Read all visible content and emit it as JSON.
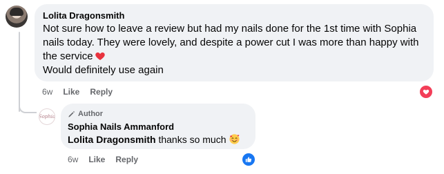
{
  "comment": {
    "author": "Lolita Dragonsmith",
    "text": "Not sure how to leave a review but had my nails done for the 1st time with Sophia nails today. They were lovely, and despite a power cut I was more than happy with the service",
    "text_line2": "Would definitely use again",
    "time": "6w",
    "like_label": "Like",
    "reply_label": "Reply",
    "reaction_icon": "love-reaction-icon",
    "reaction_color": "#f33e58"
  },
  "reply": {
    "badge": "Author",
    "author": "Sophia Nails Ammanford",
    "mention": "Lolita Dragonsmith",
    "text": "thanks so much",
    "avatar_text": "Sophia",
    "time": "6w",
    "like_label": "Like",
    "reply_label": "Reply",
    "reaction_icon": "like-reaction-icon",
    "reaction_color": "#1877f2"
  }
}
